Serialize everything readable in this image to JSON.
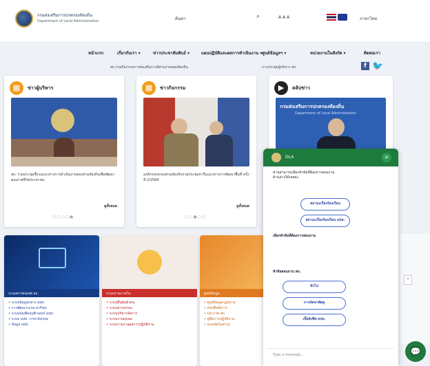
{
  "header": {
    "org_th": "กรมส่งเสริมการปกครองท้องถิ่น",
    "org_en": "Department of Local Administration",
    "search_label": "ค้นหา",
    "font_controls": "A A A",
    "lang_label": "ภาษาไทย"
  },
  "nav": [
    "หน้าแรก",
    "เกี่ยวกับเรา ▾",
    "ข่าวประชาสัมพันธ์ ▾",
    "แผนปฏิบัติและผลการดำเนินงาน ▾",
    "ศูนย์ข้อมูลฯ ▾",
    "หน่วยงานในสังกัด ▾",
    "ติดต่อเรา"
  ],
  "ticker": [
    "สถ.ร่วมกิจกรรมการส่งเสริมการมีส่วนร่วมของท้องถิ่น",
    "การประชุมผู้บริหาร สถ."
  ],
  "cards": [
    {
      "title": "ข่าวผู้บริหาร",
      "caption": "สถ. ร่วมประชุมชี้แจงแนวทางการดำเนินงานของส่วนท้องถิ่นเพื่อพัฒนาคุณภาพชีวิตประชาชน",
      "more": "ดูทั้งหมด",
      "dots": "○○○○●"
    },
    {
      "title": "ข่าวกิจกรรม",
      "caption": "องค์กรปกครองส่วนท้องถิ่นร่วมประชุมหารือแนวทางการพัฒนาพื้นที่ ครั้งที่ 2/2564",
      "more": "ดูทั้งหมด",
      "dots": "○○●○○"
    },
    {
      "title": "คลิปข่าว",
      "banner": "กรมส่งเสริมการปกครองท้องถิ่น",
      "banner_en": "Department of Local Administration"
    }
  ],
  "tiles": [
    {
      "band": "ระบบสารสนเทศ สถ.",
      "items": [
        "ระบบข้อมูลกลาง อปท.",
        "การพัฒนาระบบ e-Plan",
        "ระบบบัญชีคอมพิวเตอร์ อปท.",
        "ระบบ อปท. ภาษาอังกฤษ",
        "ข้อมูล อปท."
      ]
    },
    {
      "band": "ระบบงานภายใน",
      "items": [
        "ระบบยืนยันตัวตน",
        "ระบบสารบรรณ",
        "ระบบบริหารจัดการ",
        "ระบบงานบุคคล",
        "ระบบรายงานผลการปฏิบัติงาน"
      ]
    },
    {
      "band": "ศูนย์ข้อมูล",
      "items": [
        "ศูนย์ข้อมูลกฎหมาย",
        "หนังสือสั่งการ",
        "ประกาศ สถ.",
        "คู่มือการปฏิบัติงาน",
        "แบบฟอร์มต่างๆ"
      ]
    }
  ],
  "chat": {
    "name": "DLA",
    "intro": "ท่านสามารถเลือกหัวข้อที่ต้องการสอบถามด้านล่างได้เลยค่ะ",
    "btn1": "สถานะเรื่องร้องเรียน",
    "btn2": "สถานะเรื่องร้องเรียน อปท.",
    "prompt": "เลือกหัวข้อที่ต้องการสอบถาม",
    "section": "หัวข้อสอบถาม สถ.",
    "opt1": "ทั่วไป",
    "opt2": "การจัดหาพัสดุ",
    "opt3": "เบี้ยยังชีพ อปท.",
    "input_placeholder": "Type a message..."
  }
}
